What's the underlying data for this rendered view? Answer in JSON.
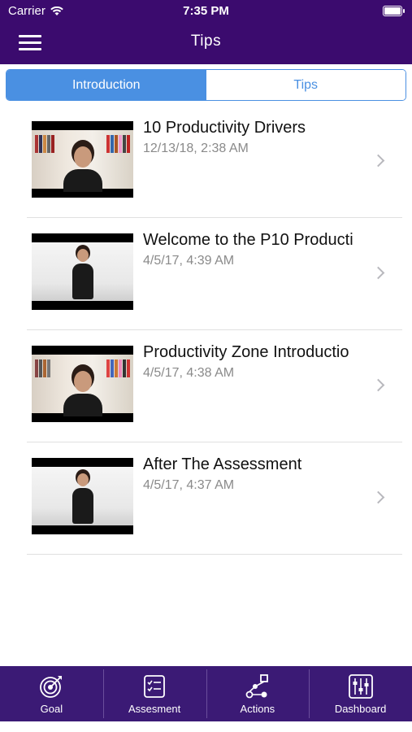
{
  "status_bar": {
    "carrier": "Carrier",
    "time": "7:35 PM"
  },
  "nav": {
    "title": "Tips",
    "menu_icon": "hamburger-menu-icon"
  },
  "segments": [
    {
      "label": "Introduction",
      "active": true
    },
    {
      "label": "Tips",
      "active": false
    }
  ],
  "videos": [
    {
      "title": "10 Productivity Drivers",
      "date": "12/13/18, 2:38 AM"
    },
    {
      "title": "Welcome to the P10 Producti",
      "date": "4/5/17, 4:39 AM"
    },
    {
      "title": "Productivity Zone Introductio",
      "date": "4/5/17, 4:38 AM"
    },
    {
      "title": "After The Assessment",
      "date": "4/5/17, 4:37 AM"
    }
  ],
  "tabbar": {
    "items": [
      {
        "label": "Goal",
        "icon": "target-icon"
      },
      {
        "label": "Assesment",
        "icon": "checklist-icon"
      },
      {
        "label": "Actions",
        "icon": "flow-nodes-icon"
      },
      {
        "label": "Dashboard",
        "icon": "sliders-icon"
      }
    ]
  },
  "colors": {
    "header_bg": "#3b0b6e",
    "tabbar_bg": "#3b1a75",
    "accent": "#4a90e2"
  }
}
